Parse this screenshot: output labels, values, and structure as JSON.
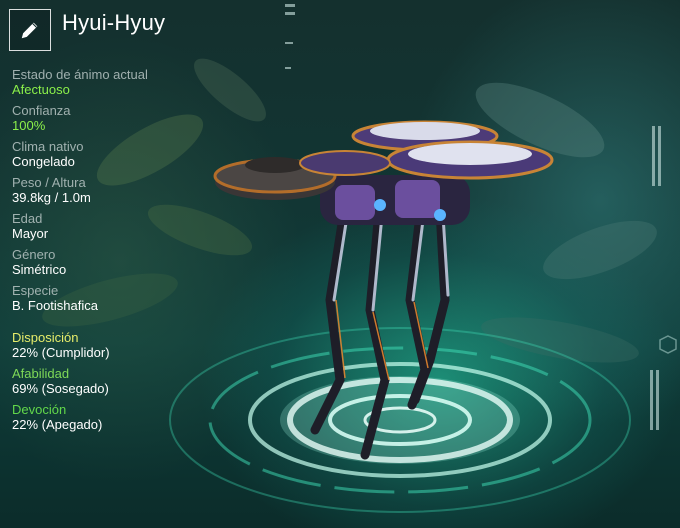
{
  "creature": {
    "name": "Hyui-Hyuy"
  },
  "icons": {
    "edit": "pencil-icon"
  },
  "stats": {
    "mood_label": "Estado de ánimo actual",
    "mood_value": "Afectuoso",
    "trust_label": "Confianza",
    "trust_value": "100%",
    "climate_label": "Clima nativo",
    "climate_value": "Congelado",
    "weight_label": "Peso / Altura",
    "weight_value": "39.8kg / 1.0m",
    "age_label": "Edad",
    "age_value": "Mayor",
    "gender_label": "Género",
    "gender_value": "Simétrico",
    "species_label": "Especie",
    "species_value": "B. Footishafica"
  },
  "traits": [
    {
      "label": "Disposición",
      "value": "22% (Cumplidor)"
    },
    {
      "label": "Afabilidad",
      "value": "69% (Sosegado)"
    },
    {
      "label": "Devoción",
      "value": "22% (Apegado)"
    }
  ],
  "colors": {
    "accent_green": "#8bf04a",
    "trait_yellow": "#e6ec6a",
    "trait_green": "#7ed957",
    "platform_glow": "#3fe0b8"
  }
}
